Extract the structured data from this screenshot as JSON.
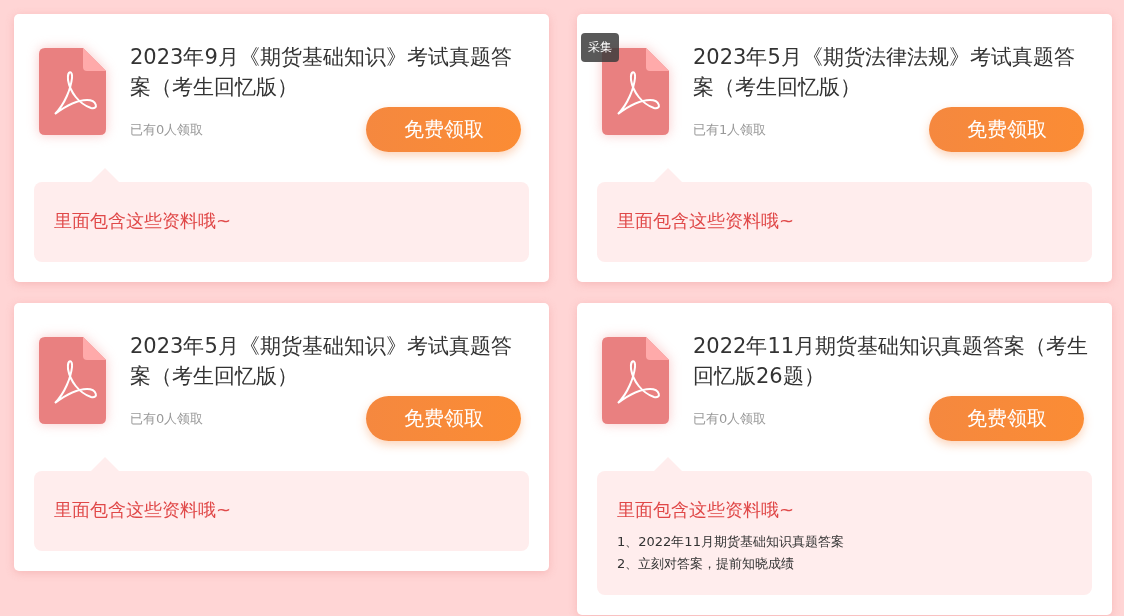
{
  "cards": [
    {
      "title": "2023年9月《期货基础知识》考试真题答案（考生回忆版）",
      "count": "已有0人领取",
      "button": "免费领取",
      "contents_heading": "里面包含这些资料哦~"
    },
    {
      "badge": "采集",
      "title": "2023年5月《期货法律法规》考试真题答案（考生回忆版）",
      "count": "已有1人领取",
      "button": "免费领取",
      "contents_heading": "里面包含这些资料哦~"
    },
    {
      "title": "2023年5月《期货基础知识》考试真题答案（考生回忆版）",
      "count": "已有0人领取",
      "button": "免费领取",
      "contents_heading": "里面包含这些资料哦~"
    },
    {
      "title": "2022年11月期货基础知识真题答案（考生回忆版26题）",
      "count": "已有0人领取",
      "button": "免费领取",
      "contents_heading": "里面包含这些资料哦~",
      "contents": [
        "1、2022年11月期货基础知识真题答案",
        "2、立刻对答案，提前知晓成绩"
      ]
    }
  ]
}
